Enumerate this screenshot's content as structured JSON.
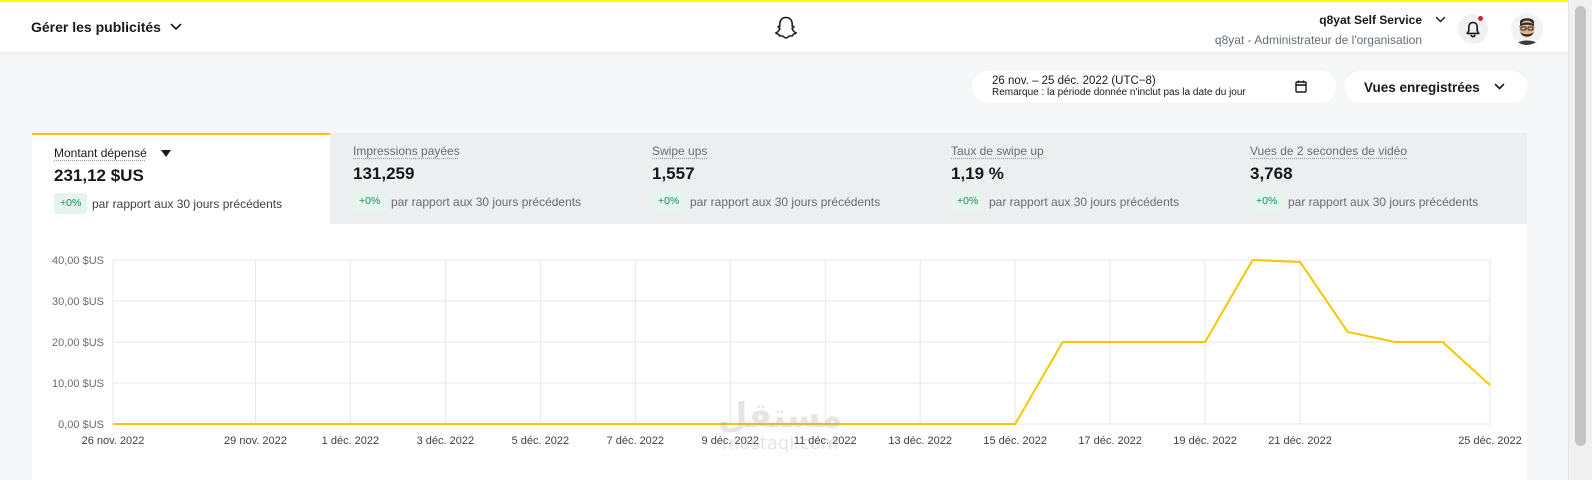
{
  "header": {
    "manage_label": "Gérer les publicités",
    "account_name": "q8yat Self Service",
    "account_role": "q8yat - Administrateur de l'organisation"
  },
  "toolbar": {
    "date_range": "26 nov. – 25 déc. 2022 (UTC−8)",
    "date_note": "Remarque : la période donnée n'inclut pas la date du jour",
    "saved_views": "Vues enregistrées"
  },
  "metrics": [
    {
      "label": "Montant dépensé",
      "value": "231,12 $US",
      "badge": "+0%",
      "comparison": "par rapport aux 30 jours précédents",
      "active": true
    },
    {
      "label": "Impressions payées",
      "value": "131,259",
      "badge": "+0%",
      "comparison": "par rapport aux 30 jours précédents",
      "active": false
    },
    {
      "label": "Swipe ups",
      "value": "1,557",
      "badge": "+0%",
      "comparison": "par rapport aux 30 jours précédents",
      "active": false
    },
    {
      "label": "Taux de swipe up",
      "value": "1,19 %",
      "badge": "+0%",
      "comparison": "par rapport aux 30 jours précédents",
      "active": false
    },
    {
      "label": "Vues de 2 secondes de vidéo",
      "value": "3,768",
      "badge": "+0%",
      "comparison": "par rapport aux 30 jours précédents",
      "active": false
    }
  ],
  "watermark": {
    "arabic": "مستقل",
    "latin": "mostaql.com"
  },
  "colors": {
    "accent": "#fffc00",
    "line": "#f7c600",
    "badge_bg": "#e6f4ee",
    "badge_text": "#1a8a5b",
    "notification": "#e1143d"
  },
  "icons": {
    "ghost": "snapchat-ghost-icon",
    "bell": "bell-icon",
    "calendar": "calendar-icon",
    "chevron": "chevron-down-icon",
    "caret": "caret-down-icon"
  },
  "chart_data": {
    "type": "line",
    "ylim": [
      0,
      40
    ],
    "y_ticks": [
      0,
      10,
      20,
      30,
      40
    ],
    "y_tick_labels": [
      "0,00 $US",
      "10,00 $US",
      "20,00 $US",
      "30,00 $US",
      "40,00 $US"
    ],
    "x_tick_labels": [
      "26 nov. 2022",
      "29 nov. 2022",
      "1 déc. 2022",
      "3 déc. 2022",
      "5 déc. 2022",
      "7 déc. 2022",
      "9 déc. 2022",
      "11 déc. 2022",
      "13 déc. 2022",
      "15 déc. 2022",
      "17 déc. 2022",
      "19 déc. 2022",
      "21 déc. 2022",
      "25 déc. 2022"
    ],
    "x_tick_days": [
      0,
      3,
      5,
      7,
      9,
      11,
      13,
      15,
      17,
      19,
      21,
      23,
      25,
      29
    ],
    "x_days": [
      0,
      1,
      2,
      3,
      4,
      5,
      6,
      7,
      8,
      9,
      10,
      11,
      12,
      13,
      14,
      15,
      16,
      17,
      18,
      19,
      20,
      21,
      22,
      23,
      24,
      25,
      26,
      27,
      28,
      29
    ],
    "values": [
      0,
      0,
      0,
      0,
      0,
      0,
      0,
      0,
      0,
      0,
      0,
      0,
      0,
      0,
      0,
      0,
      0,
      0,
      0,
      0,
      20,
      20,
      20,
      20,
      40,
      39.5,
      22.5,
      20,
      20,
      9.5
    ],
    "grid": true
  }
}
